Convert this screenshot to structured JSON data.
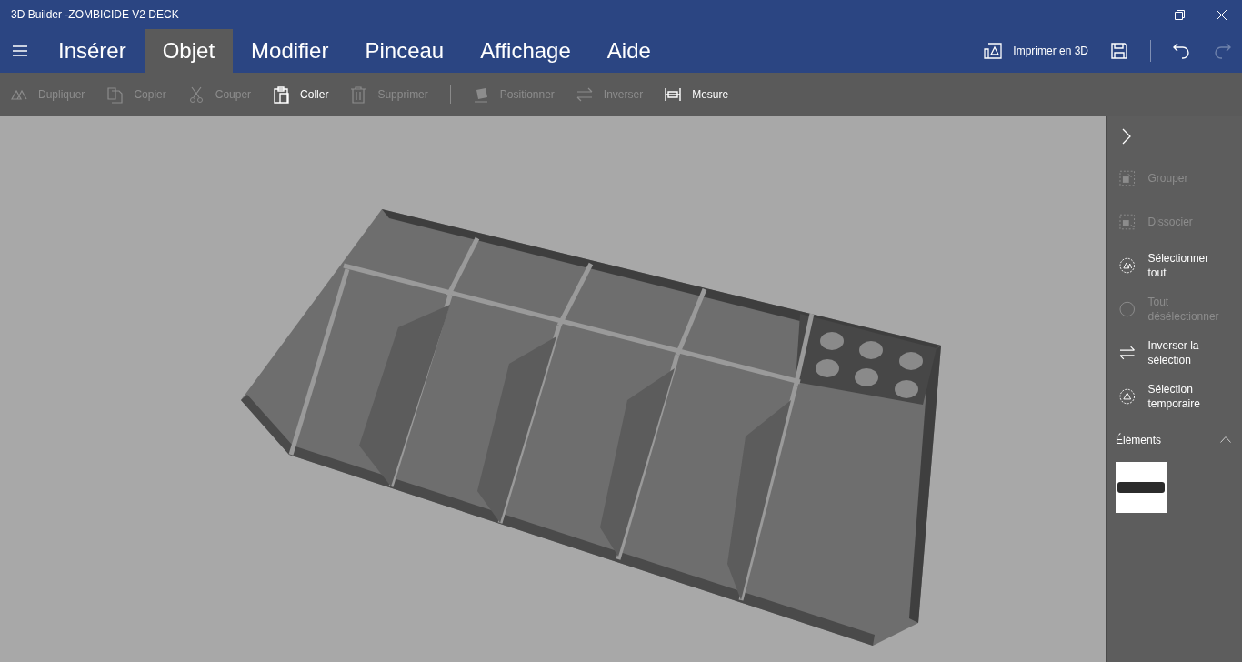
{
  "window": {
    "title": "3D Builder -ZOMBICIDE V2 DECK"
  },
  "tabs": [
    {
      "label": "Insérer",
      "selected": false
    },
    {
      "label": "Objet",
      "selected": true
    },
    {
      "label": "Modifier",
      "selected": false
    },
    {
      "label": "Pinceau",
      "selected": false
    },
    {
      "label": "Affichage",
      "selected": false
    },
    {
      "label": "Aide",
      "selected": false
    }
  ],
  "print_button": {
    "label": "Imprimer en 3D"
  },
  "toolbar": [
    {
      "kind": "duplicate",
      "label": "Dupliquer",
      "disabled": true
    },
    {
      "kind": "copy",
      "label": "Copier",
      "disabled": true
    },
    {
      "kind": "cut",
      "label": "Couper",
      "disabled": true
    },
    {
      "kind": "paste",
      "label": "Coller",
      "disabled": false
    },
    {
      "kind": "delete",
      "label": "Supprimer",
      "disabled": true
    },
    {
      "kind": "position",
      "label": "Positionner",
      "disabled": true
    },
    {
      "kind": "invert",
      "label": "Inverser",
      "disabled": true
    },
    {
      "kind": "measure",
      "label": "Mesure",
      "disabled": false
    }
  ],
  "side_panel": {
    "items": [
      {
        "kind": "group",
        "label": "Grouper",
        "disabled": true
      },
      {
        "kind": "ungroup",
        "label": "Dissocier",
        "disabled": true
      },
      {
        "kind": "select_all",
        "label": "Sélectionner tout",
        "disabled": false
      },
      {
        "kind": "deselect",
        "label": "Tout désélectionner",
        "disabled": true
      },
      {
        "kind": "invert",
        "label": "Inverser la sélection",
        "disabled": false
      },
      {
        "kind": "temp",
        "label": "Sélection temporaire",
        "disabled": false
      }
    ],
    "elements_heading": "Éléments"
  }
}
